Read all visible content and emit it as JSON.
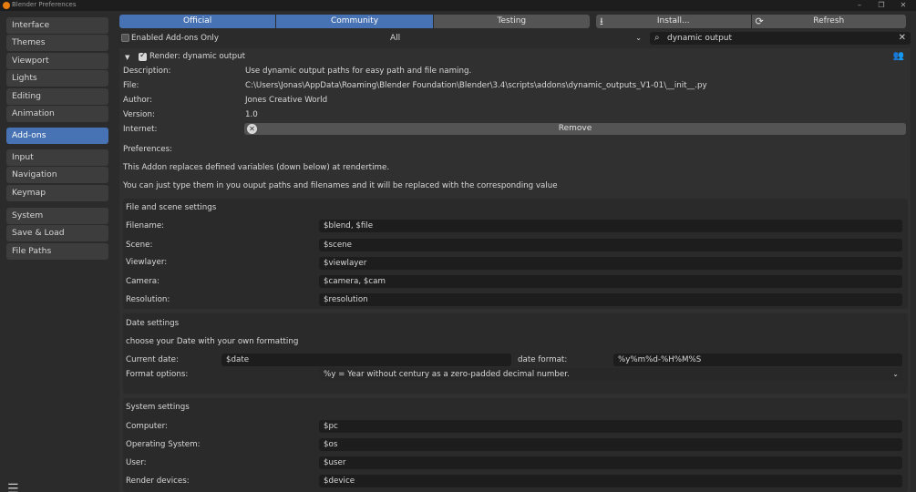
{
  "window": {
    "title": "Blender Preferences",
    "minimize": "–",
    "restore": "❐",
    "close": "✕"
  },
  "sidebar": {
    "groups": [
      [
        "Interface",
        "Themes",
        "Viewport",
        "Lights",
        "Editing",
        "Animation"
      ],
      [
        "Add-ons"
      ],
      [
        "Input",
        "Navigation",
        "Keymap"
      ],
      [
        "System",
        "Save & Load",
        "File Paths"
      ]
    ],
    "active": "Add-ons",
    "menu_icon": "☰"
  },
  "tabs": [
    "Official",
    "Community",
    "Testing"
  ],
  "active_tabs": [
    "Official",
    "Community"
  ],
  "actions": {
    "install": "Install...",
    "refresh": "Refresh",
    "install_icon": "download-icon",
    "refresh_icon": "refresh-icon"
  },
  "filter": {
    "enabled_only_label": "Enabled Add-ons Only",
    "enabled_only": false,
    "category": "All",
    "search": "dynamic output"
  },
  "addon": {
    "expanded": true,
    "enabled": true,
    "name": "Render: dynamic output",
    "description_label": "Description:",
    "description": "Use dynamic output paths for easy path and file naming.",
    "file_label": "File:",
    "file": "C:\\Users\\Jonas\\AppData\\Roaming\\Blender Foundation\\Blender\\3.4\\scripts\\addons\\dynamic_outputs_V1-01\\__init__.py",
    "author_label": "Author:",
    "author": "Jones Creative World",
    "version_label": "Version:",
    "version": "1.0",
    "internet_label": "Internet:",
    "remove_label": "Remove"
  },
  "preferences": {
    "heading": "Preferences:",
    "intro1": "This Addon replaces defined variables (down below) at rendertime.",
    "intro2": "You can just type them in you ouput paths and filenames and it will be replaced with the corresponding value",
    "file_scene": {
      "title": "File and scene settings",
      "rows": [
        {
          "label": "Filename:",
          "value": "$blend, $file"
        },
        {
          "label": "Scene:",
          "value": "$scene"
        },
        {
          "label": "Viewlayer:",
          "value": "$viewlayer"
        },
        {
          "label": "Camera:",
          "value": "$camera, $cam"
        },
        {
          "label": "Resolution:",
          "value": "$resolution"
        }
      ]
    },
    "date": {
      "title": "Date settings",
      "note": "choose your Date with your own formatting",
      "current_label": "Current date:",
      "current_value": "$date",
      "format_label": "date format:",
      "format_value": "%y%m%d-%H%M%S",
      "options_label": "Format options:",
      "options_value": "%y = Year without century as a zero-padded decimal number."
    },
    "system": {
      "title": "System settings",
      "rows": [
        {
          "label": "Computer:",
          "value": "$pc"
        },
        {
          "label": "Operating System:",
          "value": "$os"
        },
        {
          "label": "User:",
          "value": "$user"
        },
        {
          "label": "Render devices:",
          "value": "$device"
        }
      ]
    }
  },
  "colors": {
    "accent": "#4772b3",
    "bg": "#2b2b2b",
    "panel": "#303030",
    "field": "#1d1d1d"
  }
}
